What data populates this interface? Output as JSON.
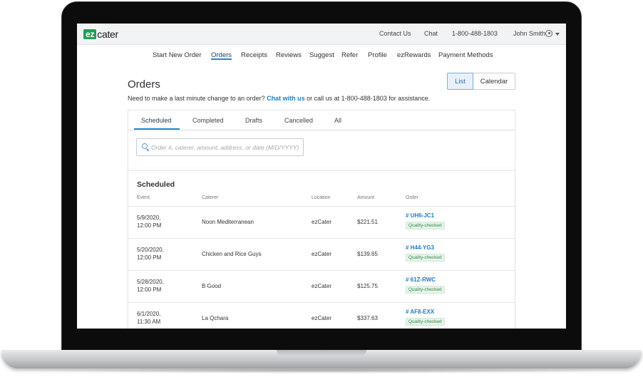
{
  "logo": {
    "ez": "ez",
    "rest": "cater"
  },
  "topbar": {
    "contact": "Contact Us",
    "chat": "Chat",
    "phone": "1-800-488-1803",
    "user": "John Smith"
  },
  "nav": [
    "Start New Order",
    "Orders",
    "Receipts",
    "Reviews",
    "Suggest",
    "Refer",
    "Profile",
    "ezRewards",
    "Payment Methods"
  ],
  "page": {
    "title": "Orders",
    "help_prefix": "Need to make a last minute change to an order?",
    "help_link": "Chat with us",
    "help_suffix": "or call us at 1-800-488-1803 for assistance."
  },
  "view_toggle": {
    "list": "List",
    "calendar": "Calendar",
    "selected": "List"
  },
  "tabs": [
    "Scheduled",
    "Completed",
    "Drafts",
    "Cancelled",
    "All"
  ],
  "search": {
    "placeholder": "Order #, caterer, amount, address, or date (M/D/YYYY)"
  },
  "table": {
    "title": "Scheduled",
    "headers": [
      "Event",
      "Caterer",
      "Location",
      "Amount",
      "Order"
    ],
    "rows": [
      {
        "date": "5/9/2020,",
        "time": "12:00 PM",
        "caterer": "Noon Mediterranean",
        "location": "ezCater",
        "amount": "$221.51",
        "order": "# UH6-JC1",
        "badge": "Quality-checked"
      },
      {
        "date": "5/20/2020,",
        "time": "12:00 PM",
        "caterer": "Chicken and Rice Guys",
        "location": "ezCater",
        "amount": "$139.65",
        "order": "# H44-YG3",
        "badge": "Quality-checked"
      },
      {
        "date": "5/28/2020,",
        "time": "12:00 PM",
        "caterer": "B Good",
        "location": "ezCater",
        "amount": "$125.75",
        "order": "# 61Z-RWC",
        "badge": "Quality-checked"
      },
      {
        "date": "6/1/2020,",
        "time": "11:30 AM",
        "caterer": "La Qchara",
        "location": "ezCater",
        "amount": "$337.63",
        "order": "# AF8-EXX",
        "badge": "Quality-checked"
      }
    ]
  },
  "colors": {
    "brand": "#1f9f56",
    "link": "#1f7dc1",
    "accent": "#1f8bd1"
  }
}
